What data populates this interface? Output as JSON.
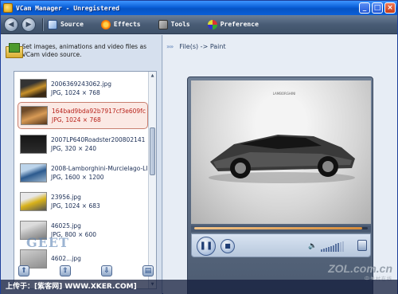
{
  "window": {
    "title": "VCam Manager - Unregistered",
    "buttons": {
      "minimize": "_",
      "maximize": "□",
      "close": "×"
    }
  },
  "toolbar": {
    "back_icon": "◀",
    "forward_icon": "▶",
    "menus": [
      {
        "label": "Source",
        "icon": "source-icon"
      },
      {
        "label": "Effects",
        "icon": "effects-icon"
      },
      {
        "label": "Tools",
        "icon": "tools-icon"
      },
      {
        "label": "Preference",
        "icon": "preference-icon"
      }
    ]
  },
  "left": {
    "hint": "Set images, animations and video files as VCam video source.",
    "files": [
      {
        "name": "2006369243062.jpg",
        "meta": "JPG, 1024 × 768",
        "selected": false
      },
      {
        "name": "164bad9bda92b7917cf3e609fc",
        "meta": "JPG, 1024 × 768",
        "selected": true
      },
      {
        "name": "2007LP640Roadster200802141",
        "meta": "JPG, 320 × 240",
        "selected": false
      },
      {
        "name": "2008-Lamborghini-Murcielago-LI",
        "meta": "JPG, 1600 × 1200",
        "selected": false
      },
      {
        "name": "23956.jpg",
        "meta": "JPG, 1024 × 683",
        "selected": false
      },
      {
        "name": "46025.jpg",
        "meta": "JPG, 800 × 600",
        "selected": false
      },
      {
        "name": "4602...jpg",
        "meta": "",
        "selected": false
      }
    ],
    "bottom_buttons": [
      "⇑",
      "⇧",
      "⇩",
      "▤"
    ]
  },
  "right": {
    "breadcrumb_arrow": "»»",
    "breadcrumb": "File(s) -> Paint",
    "progress": 0.97,
    "video_logo": "LAMBORGHINI",
    "controls": {
      "pause_label": "❚❚",
      "stop_label": "■",
      "volume_icon": "🔈",
      "volume_level": 0.8
    }
  },
  "watermarks": {
    "zol_main": "ZOL.com.cn",
    "zol_sub": "中关村在线",
    "strip": "上传于：[紫客网] WWW.XKER.COM]",
    "badge": "GEET"
  }
}
